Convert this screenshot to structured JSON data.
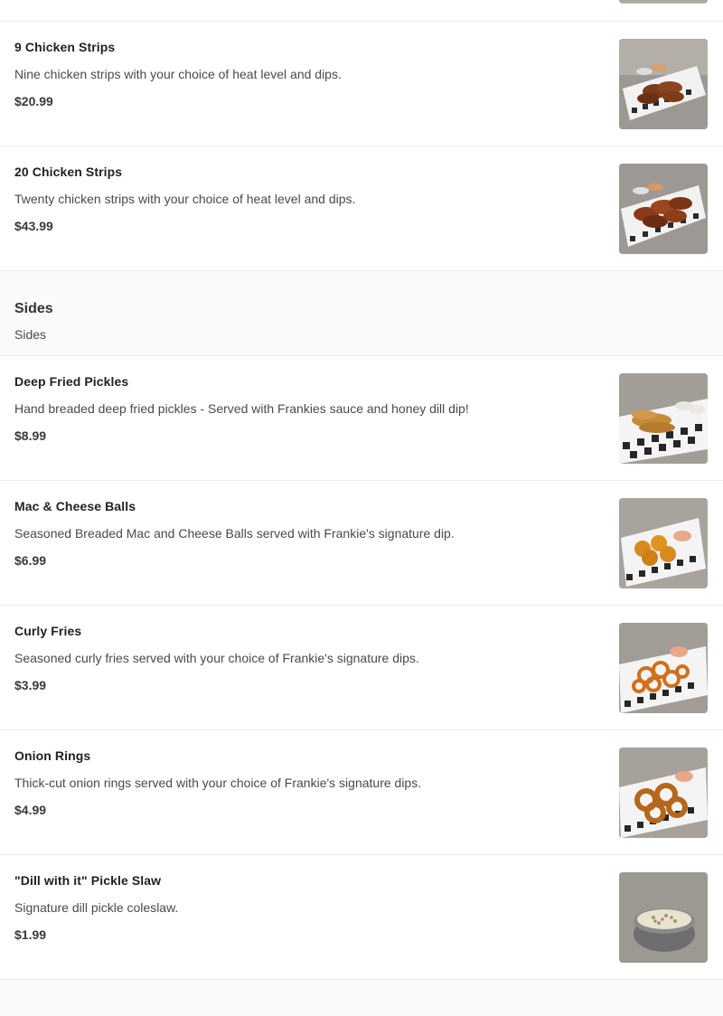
{
  "sections": [
    {
      "items": [
        {
          "name": "9 Chicken Strips",
          "description": "Nine chicken strips with your choice of heat level and dips.",
          "price": "$20.99",
          "image_icon": "chicken-strips-icon"
        },
        {
          "name": "20 Chicken Strips",
          "description": "Twenty chicken strips with your choice of heat level and dips.",
          "price": "$43.99",
          "image_icon": "chicken-strips-icon"
        }
      ]
    },
    {
      "title": "Sides",
      "subtitle": "Sides",
      "items": [
        {
          "name": "Deep Fried Pickles",
          "description": "Hand breaded deep fried pickles - Served with Frankies sauce and honey dill dip!",
          "price": "$8.99",
          "image_icon": "fried-pickles-icon"
        },
        {
          "name": "Mac & Cheese Balls",
          "description": "Seasoned Breaded Mac and Cheese Balls served with Frankie's signature dip.",
          "price": "$6.99",
          "image_icon": "mac-cheese-balls-icon"
        },
        {
          "name": "Curly Fries",
          "description": "Seasoned curly fries served with your choice of Frankie's signature dips.",
          "price": "$3.99",
          "image_icon": "curly-fries-icon"
        },
        {
          "name": "Onion Rings",
          "description": "Thick-cut onion rings served with your choice of Frankie's signature dips.",
          "price": "$4.99",
          "image_icon": "onion-rings-icon"
        },
        {
          "name": "\"Dill with it\" Pickle Slaw",
          "description": "Signature dill pickle coleslaw.",
          "price": "$1.99",
          "image_icon": "pickle-slaw-icon"
        }
      ]
    }
  ],
  "colors": {
    "divider": "#ececec",
    "section_bg": "#fafaf8",
    "text_primary": "#222222",
    "text_secondary": "#4a4a4a"
  }
}
